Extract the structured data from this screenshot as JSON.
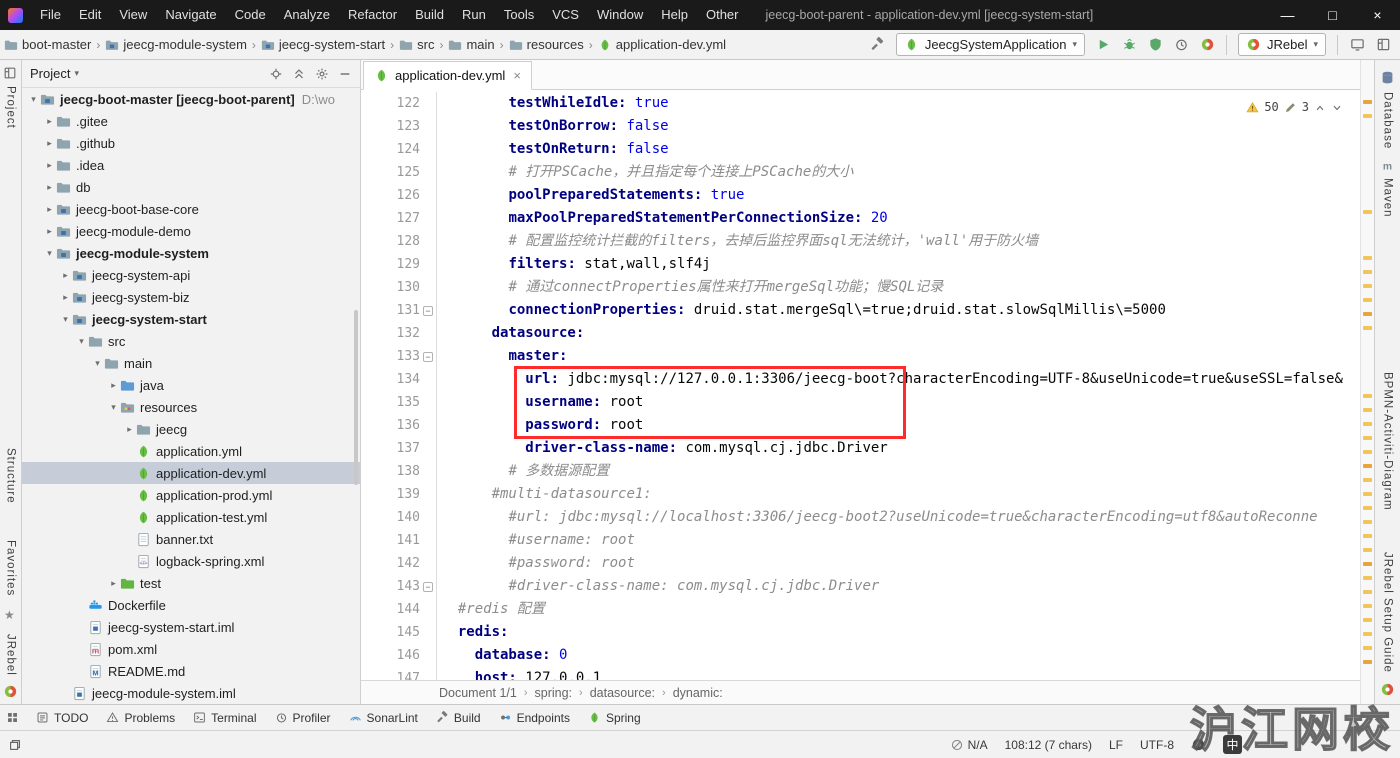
{
  "window": {
    "title": "jeecg-boot-parent - application-dev.yml [jeecg-system-start]",
    "menu_items": [
      "File",
      "Edit",
      "View",
      "Navigate",
      "Code",
      "Analyze",
      "Refactor",
      "Build",
      "Run",
      "Tools",
      "VCS",
      "Window",
      "Help",
      "Other"
    ],
    "controls": {
      "minimize": "—",
      "maximize": "□",
      "close": "×"
    }
  },
  "navbar": {
    "breadcrumbs": [
      {
        "label": "boot-master",
        "icon": "folder"
      },
      {
        "label": "jeecg-module-system",
        "icon": "module"
      },
      {
        "label": "jeecg-system-start",
        "icon": "module"
      },
      {
        "label": "src",
        "icon": "folder"
      },
      {
        "label": "main",
        "icon": "folder"
      },
      {
        "label": "resources",
        "icon": "folder"
      },
      {
        "label": "application-dev.yml",
        "icon": "spring"
      }
    ],
    "run_config": {
      "icon": "spring",
      "label": "JeecgSystemApplication"
    },
    "run_icons": [
      "hammer",
      "play",
      "debug",
      "coverage",
      "profiler",
      "rebel"
    ],
    "jrebel_combo": {
      "icon": "rebel",
      "label": "JRebel"
    },
    "right_icons": [
      "screen",
      "layout"
    ]
  },
  "left_stripe": {
    "top": [
      "Project"
    ],
    "bottom": [
      "Structure",
      "Favorites",
      "JRebel"
    ]
  },
  "right_stripe": {
    "top": [
      "Database",
      "Maven"
    ],
    "middle": [
      "BPMN-Activiti-Diagram"
    ],
    "bottom": [
      "JRebel Setup Guide"
    ]
  },
  "project_panel": {
    "title": "Project",
    "tree": [
      {
        "label": "jeecg-boot-master [jeecg-boot-parent]",
        "path": "D:\\wo",
        "icon": "project",
        "lvl": 0,
        "chev": "v",
        "bold": true
      },
      {
        "label": ".gitee",
        "icon": "folder",
        "lvl": 1,
        "chev": ">"
      },
      {
        "label": ".github",
        "icon": "folder",
        "lvl": 1,
        "chev": ">"
      },
      {
        "label": ".idea",
        "icon": "folder",
        "lvl": 1,
        "chev": ">"
      },
      {
        "label": "db",
        "icon": "folder",
        "lvl": 1,
        "chev": ">"
      },
      {
        "label": "jeecg-boot-base-core",
        "icon": "module",
        "lvl": 1,
        "chev": ">"
      },
      {
        "label": "jeecg-module-demo",
        "icon": "module",
        "lvl": 1,
        "chev": ">"
      },
      {
        "label": "jeecg-module-system",
        "icon": "module",
        "lvl": 1,
        "chev": "v",
        "bold": true
      },
      {
        "label": "jeecg-system-api",
        "icon": "module",
        "lvl": 2,
        "chev": ">"
      },
      {
        "label": "jeecg-system-biz",
        "icon": "module",
        "lvl": 2,
        "chev": ">"
      },
      {
        "label": "jeecg-system-start",
        "icon": "module",
        "lvl": 2,
        "chev": "v",
        "bold": true
      },
      {
        "label": "src",
        "icon": "folder",
        "lvl": 3,
        "chev": "v"
      },
      {
        "label": "main",
        "icon": "folder",
        "lvl": 4,
        "chev": "v"
      },
      {
        "label": "java",
        "icon": "folder-src",
        "lvl": 5,
        "chev": ">"
      },
      {
        "label": "resources",
        "icon": "folder-res",
        "lvl": 5,
        "chev": "v"
      },
      {
        "label": "jeecg",
        "icon": "folder",
        "lvl": 6,
        "chev": ">"
      },
      {
        "label": "application.yml",
        "icon": "spring",
        "lvl": 6
      },
      {
        "label": "application-dev.yml",
        "icon": "spring",
        "lvl": 6,
        "selected": true
      },
      {
        "label": "application-prod.yml",
        "icon": "spring",
        "lvl": 6
      },
      {
        "label": "application-test.yml",
        "icon": "spring",
        "lvl": 6
      },
      {
        "label": "banner.txt",
        "icon": "txt",
        "lvl": 6
      },
      {
        "label": "logback-spring.xml",
        "icon": "xml",
        "lvl": 6
      },
      {
        "label": "test",
        "icon": "folder-test",
        "lvl": 5,
        "chev": ">"
      },
      {
        "label": "Dockerfile",
        "icon": "docker",
        "lvl": 3
      },
      {
        "label": "jeecg-system-start.iml",
        "icon": "iml",
        "lvl": 3
      },
      {
        "label": "pom.xml",
        "icon": "maven",
        "lvl": 3
      },
      {
        "label": "README.md",
        "icon": "md",
        "lvl": 3
      },
      {
        "label": "jeecg-module-system.iml",
        "icon": "iml",
        "lvl": 2
      }
    ]
  },
  "editor": {
    "tab": {
      "icon": "spring",
      "label": "application-dev.yml",
      "close": "×"
    },
    "inspections": {
      "warnings": "50",
      "typos": "3"
    },
    "red_box": {
      "from_line": 134,
      "to_line": 136
    },
    "breadcrumbs": [
      "Document 1/1",
      "spring:",
      "datasource:",
      "dynamic:"
    ],
    "lines": [
      {
        "n": 122,
        "i": 8,
        "s": [
          [
            "testWhileIdle:",
            "k"
          ],
          [
            " true",
            "v"
          ]
        ]
      },
      {
        "n": 123,
        "i": 8,
        "s": [
          [
            "testOnBorrow:",
            "k"
          ],
          [
            " false",
            "v"
          ]
        ]
      },
      {
        "n": 124,
        "i": 8,
        "s": [
          [
            "testOnReturn:",
            "k"
          ],
          [
            " false",
            "v"
          ]
        ]
      },
      {
        "n": 125,
        "i": 8,
        "s": [
          [
            "# 打开PSCache，并且指定每个连接上PSCache的大小",
            "c"
          ]
        ]
      },
      {
        "n": 126,
        "i": 8,
        "s": [
          [
            "poolPreparedStatements:",
            "k"
          ],
          [
            " true",
            "v"
          ]
        ]
      },
      {
        "n": 127,
        "i": 8,
        "s": [
          [
            "maxPoolPreparedStatementPerConnectionSize:",
            "k"
          ],
          [
            " 20",
            "v"
          ]
        ]
      },
      {
        "n": 128,
        "i": 8,
        "s": [
          [
            "# 配置监控统计拦截的filters，去掉后监控界面sql无法统计，'wall'用于防火墙",
            "c"
          ]
        ]
      },
      {
        "n": 129,
        "i": 8,
        "s": [
          [
            "filters:",
            "k"
          ],
          [
            " stat,wall,slf4j",
            "t"
          ]
        ]
      },
      {
        "n": 130,
        "i": 8,
        "s": [
          [
            "# 通过connectProperties属性来打开mergeSql功能；慢SQL记录",
            "c"
          ]
        ]
      },
      {
        "n": 131,
        "i": 8,
        "s": [
          [
            "connectionProperties:",
            "k"
          ],
          [
            " druid.stat.mergeSql\\=true;druid.stat.slowSqlMillis\\=5000",
            "t"
          ]
        ],
        "fold": true
      },
      {
        "n": 132,
        "i": 6,
        "s": [
          [
            "datasource:",
            "k"
          ]
        ]
      },
      {
        "n": 133,
        "i": 8,
        "s": [
          [
            "master:",
            "k"
          ]
        ],
        "fold": true
      },
      {
        "n": 134,
        "i": 10,
        "s": [
          [
            "url:",
            "k"
          ],
          [
            " jdbc:mysql://127.0.0.1:3306/jeecg-boot?characterEncoding=UTF-8&useUnicode=true&useSSL=false&",
            "t"
          ]
        ]
      },
      {
        "n": 135,
        "i": 10,
        "s": [
          [
            "username:",
            "k"
          ],
          [
            " root",
            "t"
          ]
        ]
      },
      {
        "n": 136,
        "i": 10,
        "s": [
          [
            "password:",
            "k"
          ],
          [
            " root",
            "t"
          ]
        ]
      },
      {
        "n": 137,
        "i": 10,
        "s": [
          [
            "driver-class-name:",
            "k"
          ],
          [
            " com.mysql.cj.jdbc.Driver",
            "t"
          ]
        ]
      },
      {
        "n": 138,
        "i": 8,
        "s": [
          [
            "# 多数据源配置",
            "c"
          ]
        ]
      },
      {
        "n": 139,
        "i": 6,
        "s": [
          [
            "#multi-datasource1:",
            "c"
          ]
        ]
      },
      {
        "n": 140,
        "i": 8,
        "s": [
          [
            "#url: jdbc:mysql://localhost:3306/jeecg-boot2?useUnicode=true&characterEncoding=utf8&autoReconne",
            "c"
          ]
        ]
      },
      {
        "n": 141,
        "i": 8,
        "s": [
          [
            "#username: root",
            "c"
          ]
        ]
      },
      {
        "n": 142,
        "i": 8,
        "s": [
          [
            "#password: root",
            "c"
          ]
        ]
      },
      {
        "n": 143,
        "i": 8,
        "s": [
          [
            "#driver-class-name: com.mysql.cj.jdbc.Driver",
            "c"
          ]
        ],
        "fold": true
      },
      {
        "n": 144,
        "i": 2,
        "s": [
          [
            "#redis 配置",
            "c"
          ]
        ]
      },
      {
        "n": 145,
        "i": 2,
        "s": [
          [
            "redis:",
            "k"
          ]
        ]
      },
      {
        "n": 146,
        "i": 4,
        "s": [
          [
            "database:",
            "k"
          ],
          [
            " 0",
            "v"
          ]
        ]
      },
      {
        "n": 147,
        "i": 4,
        "s": [
          [
            "host:",
            "k"
          ],
          [
            " 127.0.0.1",
            "t"
          ]
        ]
      }
    ]
  },
  "tool_buttons": [
    "TODO",
    "Problems",
    "Terminal",
    "Profiler",
    "SonarLint",
    "Build",
    "Endpoints",
    "Spring"
  ],
  "status_bar": {
    "no_vcs": "N/A",
    "caret": "108:12 (7 chars)",
    "line_separator": "LF",
    "encoding": "UTF-8",
    "ime": "中"
  },
  "watermark": "沪江网校",
  "colors": {
    "accent_red": "#ff2b2b",
    "warning_mark": "#f2c55c",
    "spring_green": "#68BD45",
    "selection": "#c6cdd8"
  }
}
